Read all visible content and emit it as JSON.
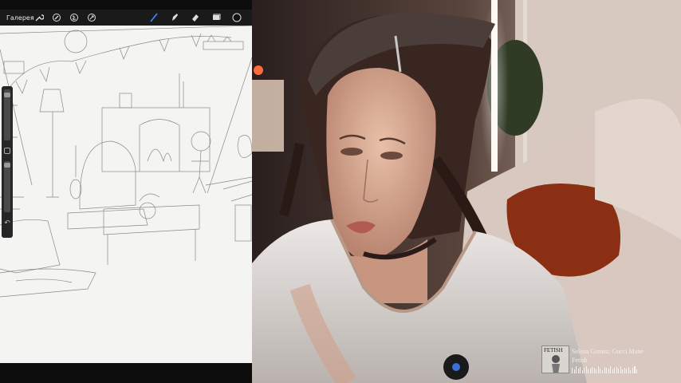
{
  "app": {
    "gallery_label": "Галерея",
    "toolbar_icons": [
      "wrench-icon",
      "magic-wand-icon",
      "selection-icon",
      "transform-icon",
      "brush-icon",
      "smudge-icon",
      "eraser-icon",
      "layers-icon",
      "color-icon"
    ],
    "accent_color": "#3b8cff"
  },
  "now_playing": {
    "artwork_title": "FETISH",
    "artist": "Selena Gomez, Gucci Mane",
    "track": "Fetish",
    "waveform": [
      0.7,
      0.5,
      0.9,
      0.6,
      0.8,
      0.4,
      0.7,
      0.9,
      0.5,
      0.6,
      0.8,
      0.7,
      0.5,
      0.9,
      0.6,
      0.4,
      0.8,
      0.7,
      0.6,
      0.9,
      0.5,
      0.7,
      0.8,
      0.6,
      0.9,
      0.5,
      0.7,
      0.6,
      0.8,
      0.4,
      0.7,
      0.9,
      0.5
    ]
  }
}
